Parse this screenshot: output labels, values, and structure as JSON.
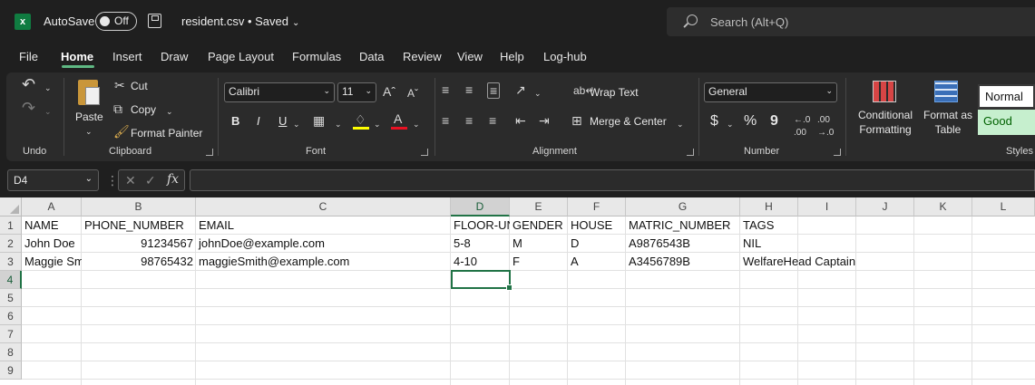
{
  "titlebar": {
    "autosave_label": "AutoSave",
    "autosave_state": "Off",
    "filename": "resident.csv • Saved",
    "search_placeholder": "Search (Alt+Q)"
  },
  "tabs": [
    "File",
    "Home",
    "Insert",
    "Draw",
    "Page Layout",
    "Formulas",
    "Data",
    "Review",
    "View",
    "Help",
    "Log-hub"
  ],
  "active_tab": "Home",
  "ribbon": {
    "undo_group": "Undo",
    "clipboard": {
      "paste": "Paste",
      "cut": "Cut",
      "copy": "Copy",
      "format_painter": "Format Painter",
      "label": "Clipboard"
    },
    "font": {
      "family": "Calibri",
      "size": "11",
      "label": "Font",
      "bold": "B",
      "italic": "I",
      "underline": "U"
    },
    "alignment": {
      "wrap_text": "Wrap Text",
      "merge_center": "Merge & Center",
      "label": "Alignment"
    },
    "number": {
      "format": "General",
      "currency": "$",
      "percent": "%",
      "comma": "9",
      "label": "Number"
    },
    "styles": {
      "conditional_formatting": "Conditional Formatting",
      "format_as_table": "Format as Table",
      "normal": "Normal",
      "good": "Good",
      "label": "Styles"
    }
  },
  "formula_bar": {
    "name_box": "D4",
    "fx": "fx",
    "value": ""
  },
  "sheet": {
    "columns": [
      "A",
      "B",
      "C",
      "D",
      "E",
      "F",
      "G",
      "H",
      "I",
      "J",
      "K",
      "L"
    ],
    "rows": [
      "1",
      "2",
      "3",
      "4",
      "5",
      "6",
      "7",
      "8",
      "9"
    ],
    "cells": [
      [
        "NAME",
        "PHONE_NUMBER",
        "EMAIL",
        "FLOOR-UNIT",
        "GENDER",
        "HOUSE",
        "MATRIC_NUMBER",
        "TAGS"
      ],
      [
        "John Doe",
        "91234567",
        "johnDoe@example.com",
        "5-8",
        "M",
        "D",
        "A9876543B",
        "NIL"
      ],
      [
        "Maggie Smith",
        "98765432",
        "maggieSmith@example.com",
        "4-10",
        "F",
        "A",
        "A3456789B",
        "WelfareHead Captain"
      ]
    ],
    "selected_cell": "D4"
  },
  "colors": {
    "accent": "#217346",
    "tab_underline": "#5fb883",
    "good_bg": "#c6efce",
    "good_text": "#006100"
  }
}
